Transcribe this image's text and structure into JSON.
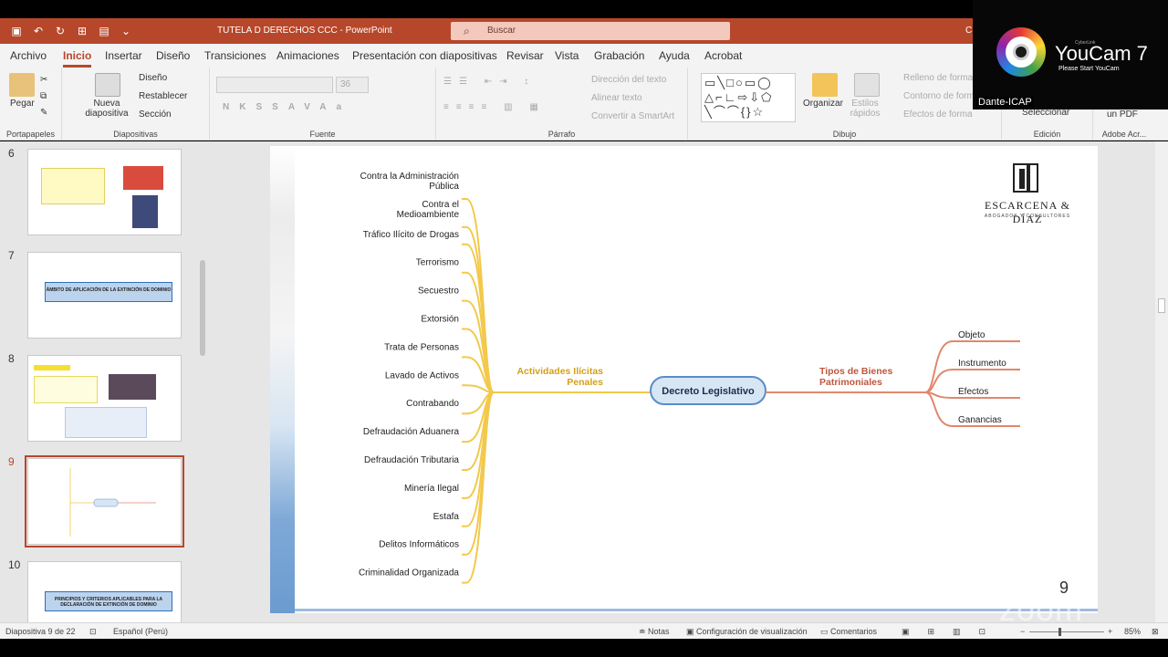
{
  "window": {
    "title": "TUTELA D DERECHOS  CCC  -  PowerPoint",
    "search_placeholder": "Buscar",
    "user_initial": "C"
  },
  "tabs": [
    "Archivo",
    "Inicio",
    "Insertar",
    "Diseño",
    "Transiciones",
    "Animaciones",
    "Presentación con diapositivas",
    "Revisar",
    "Vista",
    "Grabación",
    "Ayuda",
    "Acrobat"
  ],
  "active_tab": "Inicio",
  "ribbon": {
    "portapapeles": {
      "pegar": "Pegar",
      "label": "Portapapeles"
    },
    "diapositivas": {
      "nueva": "Nueva diapositiva",
      "diseno": "Diseño",
      "restablecer": "Restablecer",
      "seccion": "Sección",
      "label": "Diapositivas"
    },
    "fuente": {
      "size": "36",
      "buttons": [
        "N",
        "K",
        "S",
        "S",
        "AV",
        "Aa"
      ],
      "label": "Fuente"
    },
    "parrafo": {
      "direccion": "Dirección del texto",
      "alinear": "Alinear texto",
      "convertir": "Convertir a SmartArt",
      "label": "Párrafo"
    },
    "dibujo": {
      "organizar": "Organizar",
      "estilos": "Estilos rápidos",
      "relleno": "Relleno de forma",
      "contorno": "Contorno de forma",
      "efectos": "Efectos de forma",
      "label": "Dibujo"
    },
    "edicion": {
      "seleccionar": "Seleccionar",
      "label": "Edición"
    },
    "adobe": {
      "pdf": "un PDF",
      "label": "Adobe Acr..."
    }
  },
  "thumbnails": [
    {
      "num": "6",
      "text": ""
    },
    {
      "num": "7",
      "text": "ÁMBITO DE APLICACIÓN DE LA EXTINCIÓN DE DOMINIO"
    },
    {
      "num": "8",
      "text": ""
    },
    {
      "num": "9",
      "text": ""
    },
    {
      "num": "10",
      "text": "PRINCIPIOS Y CRITERIOS APLICABLES PARA LA DECLARACIÓN DE EXTINCIÓN DE DOMINIO"
    }
  ],
  "current_slide": "9",
  "slide": {
    "logo_name": "ESCARCENA & DÍAZ",
    "logo_sub": "ABOGADOS Y CONSULTORES",
    "page_number": "9",
    "center": "Decreto Legislativo",
    "left_branch": [
      "Actividades Ilícitas",
      "Penales"
    ],
    "right_branch": [
      "Tipos de Bienes",
      "Patrimoniales"
    ],
    "left_items": [
      [
        "Contra la Administración",
        "Pública"
      ],
      [
        "Contra el",
        "Medioambiente"
      ],
      [
        "Tráfico Ilícito de Drogas"
      ],
      [
        "Terrorismo"
      ],
      [
        "Secuestro"
      ],
      [
        "Extorsión"
      ],
      [
        "Trata de Personas"
      ],
      [
        "Lavado de Activos"
      ],
      [
        "Contrabando"
      ],
      [
        "Defraudación Aduanera"
      ],
      [
        "Defraudación Tributaria"
      ],
      [
        "Minería Ilegal"
      ],
      [
        "Estafa"
      ],
      [
        "Delitos Informáticos"
      ],
      [
        "Criminalidad Organizada"
      ]
    ],
    "right_items": [
      "Objeto",
      "Instrumento",
      "Efectos",
      "Ganancias"
    ],
    "colors": {
      "left": "#f2c94c",
      "right": "#e0886b",
      "center_fill": "#d6e6f5",
      "center_stroke": "#5b8cc8"
    }
  },
  "status": {
    "slide": "Diapositiva 9 de 22",
    "lang": "Español (Perú)",
    "notas": "Notas",
    "config": "Configuración de visualización",
    "comentarios": "Comentarios",
    "zoom": "85%"
  },
  "webcam": {
    "brand": "YouCam 7",
    "cyberlink": "CyberLink",
    "sub": "Please Start YouCam",
    "name": "Dante-ICAP"
  },
  "watermark": "zoom"
}
